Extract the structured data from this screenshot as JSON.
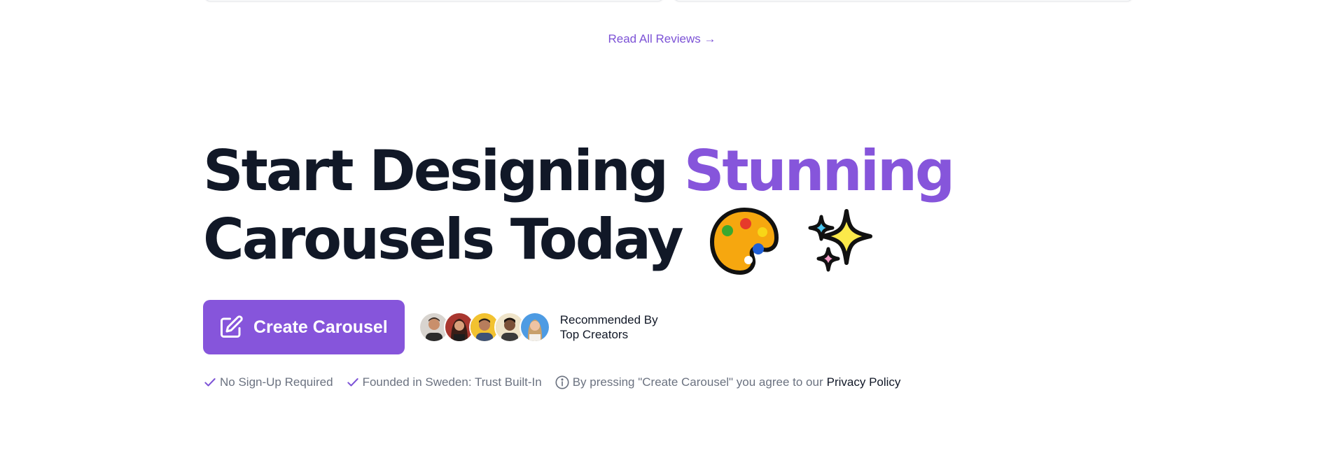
{
  "reviews": {
    "read_all_label": "Read All Reviews →"
  },
  "hero": {
    "headline_part1": "Start Designing ",
    "headline_accent": "Stunning",
    "headline_line2": "Carousels Today",
    "emojis": [
      "palette-emoji",
      "sparkles-emoji"
    ],
    "accent_color": "#8655db"
  },
  "cta": {
    "create_label": "Create Carousel",
    "icon": "edit-icon",
    "recommended_line1": "Recommended By",
    "recommended_line2": "Top Creators",
    "avatars": [
      "creator-avatar-1",
      "creator-avatar-2",
      "creator-avatar-3",
      "creator-avatar-4",
      "creator-avatar-5"
    ]
  },
  "features": {
    "no_signup": "No Sign-Up Required",
    "founded": "Founded in Sweden: Trust Built-In",
    "agreement": "By pressing \"Create Carousel\" you agree to our",
    "privacy_label": "Privacy Policy"
  }
}
